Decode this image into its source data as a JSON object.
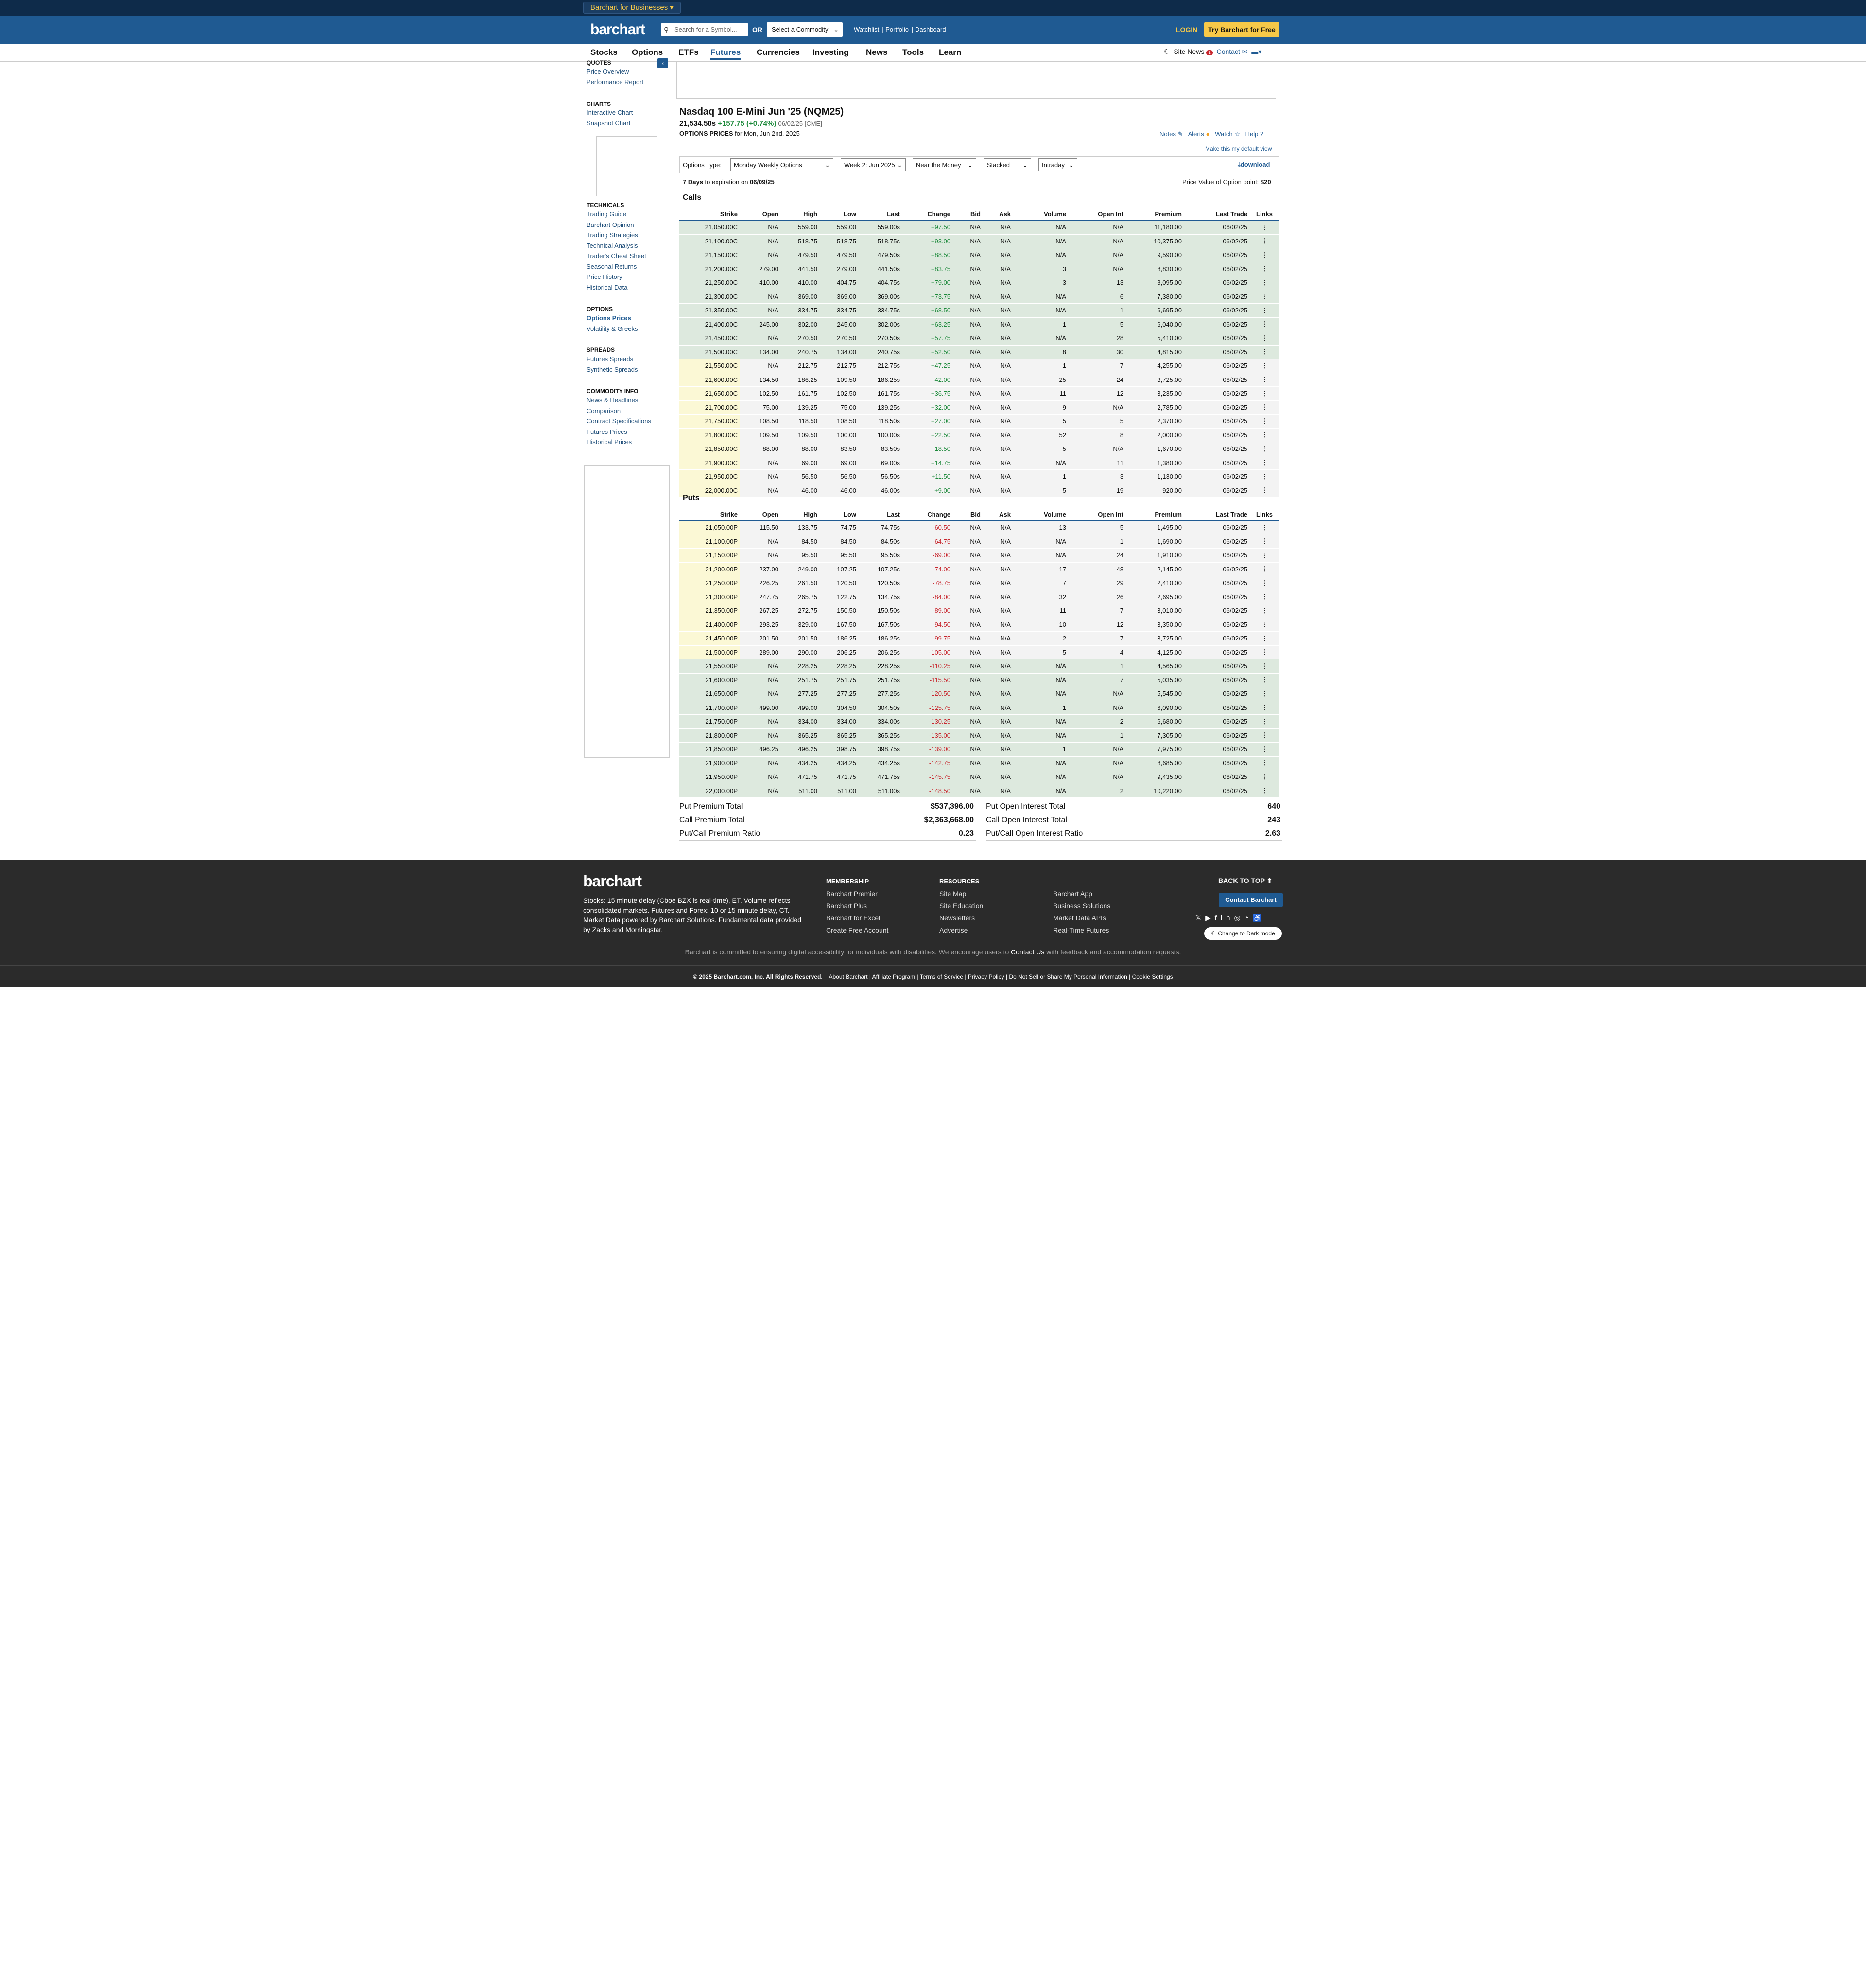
{
  "topbar": {
    "business_label": "Barchart for Businesses"
  },
  "header": {
    "logo": "barchart",
    "search_placeholder": "Search for a Symbol...",
    "or_label": "OR",
    "commodity_select": "Select a Commodity",
    "links": [
      "Watchlist",
      "Portfolio",
      "Dashboard"
    ],
    "login": "LOGIN",
    "try_button": "Try Barchart for Free"
  },
  "nav": {
    "items": [
      "Stocks",
      "Options",
      "ETFs",
      "Futures",
      "Currencies",
      "Investing",
      "News",
      "Tools",
      "Learn"
    ],
    "active": "Futures",
    "site_news": "Site News",
    "site_news_badge": "1",
    "contact": "Contact"
  },
  "sidebar": {
    "quotes_header": "QUOTES",
    "quotes": [
      "Price Overview",
      "Performance Report"
    ],
    "charts_header": "CHARTS",
    "charts": [
      "Interactive Chart",
      "Snapshot Chart"
    ],
    "technicals_header": "TECHNICALS",
    "technicals": [
      "Trading Guide",
      "Barchart Opinion",
      "Trading Strategies",
      "Technical Analysis",
      "Trader's Cheat Sheet",
      "Seasonal Returns",
      "Price History",
      "Historical Data"
    ],
    "options_header": "OPTIONS",
    "options": [
      "Options Prices",
      "Volatility & Greeks"
    ],
    "spreads_header": "SPREADS",
    "spreads": [
      "Futures Spreads",
      "Synthetic Spreads"
    ],
    "commodity_header": "COMMODITY INFO",
    "commodity": [
      "News & Headlines",
      "Comparison",
      "Contract Specifications",
      "Futures Prices",
      "Historical Prices"
    ]
  },
  "quote": {
    "title": "Nasdaq 100 E-Mini Jun '25 (NQM25)",
    "last": "21,534.50s",
    "change": "+157.75 (+0.74%)",
    "date": "06/02/25 [CME]",
    "options_prices_label": "OPTIONS PRICES",
    "for_date": "for Mon, Jun 2nd, 2025"
  },
  "tools": {
    "notes": "Notes",
    "alerts": "Alerts",
    "watch": "Watch",
    "help": "Help",
    "default_view": "Make this my default view"
  },
  "filters": {
    "options_type_label": "Options Type:",
    "options_type": "Monday Weekly Options",
    "expiration": "Week 2: Jun 2025",
    "moneyness": "Near the Money",
    "layout": "Stacked",
    "period": "Intraday",
    "download": "download"
  },
  "expiry": {
    "days": "7 Days",
    "text": "to expiration on",
    "date": "06/09/25",
    "point_label": "Price Value of Option point:",
    "point_value": "$20"
  },
  "columns": [
    "Strike",
    "Open",
    "High",
    "Low",
    "Last",
    "Change",
    "Bid",
    "Ask",
    "Volume",
    "Open Int",
    "Premium",
    "Last Trade",
    "Links"
  ],
  "calls_label": "Calls",
  "puts_label": "Puts",
  "calls": [
    [
      "21,050.00C",
      "N/A",
      "559.00",
      "559.00",
      "559.00s",
      "+97.50",
      "N/A",
      "N/A",
      "N/A",
      "N/A",
      "11,180.00",
      "06/02/25",
      "⋮"
    ],
    [
      "21,100.00C",
      "N/A",
      "518.75",
      "518.75",
      "518.75s",
      "+93.00",
      "N/A",
      "N/A",
      "N/A",
      "N/A",
      "10,375.00",
      "06/02/25",
      "⋮"
    ],
    [
      "21,150.00C",
      "N/A",
      "479.50",
      "479.50",
      "479.50s",
      "+88.50",
      "N/A",
      "N/A",
      "N/A",
      "N/A",
      "9,590.00",
      "06/02/25",
      "⋮"
    ],
    [
      "21,200.00C",
      "279.00",
      "441.50",
      "279.00",
      "441.50s",
      "+83.75",
      "N/A",
      "N/A",
      "3",
      "N/A",
      "8,830.00",
      "06/02/25",
      "⋮"
    ],
    [
      "21,250.00C",
      "410.00",
      "410.00",
      "404.75",
      "404.75s",
      "+79.00",
      "N/A",
      "N/A",
      "3",
      "13",
      "8,095.00",
      "06/02/25",
      "⋮"
    ],
    [
      "21,300.00C",
      "N/A",
      "369.00",
      "369.00",
      "369.00s",
      "+73.75",
      "N/A",
      "N/A",
      "N/A",
      "6",
      "7,380.00",
      "06/02/25",
      "⋮"
    ],
    [
      "21,350.00C",
      "N/A",
      "334.75",
      "334.75",
      "334.75s",
      "+68.50",
      "N/A",
      "N/A",
      "N/A",
      "1",
      "6,695.00",
      "06/02/25",
      "⋮"
    ],
    [
      "21,400.00C",
      "245.00",
      "302.00",
      "245.00",
      "302.00s",
      "+63.25",
      "N/A",
      "N/A",
      "1",
      "5",
      "6,040.00",
      "06/02/25",
      "⋮"
    ],
    [
      "21,450.00C",
      "N/A",
      "270.50",
      "270.50",
      "270.50s",
      "+57.75",
      "N/A",
      "N/A",
      "N/A",
      "28",
      "5,410.00",
      "06/02/25",
      "⋮"
    ],
    [
      "21,500.00C",
      "134.00",
      "240.75",
      "134.00",
      "240.75s",
      "+52.50",
      "N/A",
      "N/A",
      "8",
      "30",
      "4,815.00",
      "06/02/25",
      "⋮"
    ],
    [
      "21,550.00C",
      "N/A",
      "212.75",
      "212.75",
      "212.75s",
      "+47.25",
      "N/A",
      "N/A",
      "1",
      "7",
      "4,255.00",
      "06/02/25",
      "⋮"
    ],
    [
      "21,600.00C",
      "134.50",
      "186.25",
      "109.50",
      "186.25s",
      "+42.00",
      "N/A",
      "N/A",
      "25",
      "24",
      "3,725.00",
      "06/02/25",
      "⋮"
    ],
    [
      "21,650.00C",
      "102.50",
      "161.75",
      "102.50",
      "161.75s",
      "+36.75",
      "N/A",
      "N/A",
      "11",
      "12",
      "3,235.00",
      "06/02/25",
      "⋮"
    ],
    [
      "21,700.00C",
      "75.00",
      "139.25",
      "75.00",
      "139.25s",
      "+32.00",
      "N/A",
      "N/A",
      "9",
      "N/A",
      "2,785.00",
      "06/02/25",
      "⋮"
    ],
    [
      "21,750.00C",
      "108.50",
      "118.50",
      "108.50",
      "118.50s",
      "+27.00",
      "N/A",
      "N/A",
      "5",
      "5",
      "2,370.00",
      "06/02/25",
      "⋮"
    ],
    [
      "21,800.00C",
      "109.50",
      "109.50",
      "100.00",
      "100.00s",
      "+22.50",
      "N/A",
      "N/A",
      "52",
      "8",
      "2,000.00",
      "06/02/25",
      "⋮"
    ],
    [
      "21,850.00C",
      "88.00",
      "88.00",
      "83.50",
      "83.50s",
      "+18.50",
      "N/A",
      "N/A",
      "5",
      "N/A",
      "1,670.00",
      "06/02/25",
      "⋮"
    ],
    [
      "21,900.00C",
      "N/A",
      "69.00",
      "69.00",
      "69.00s",
      "+14.75",
      "N/A",
      "N/A",
      "N/A",
      "11",
      "1,380.00",
      "06/02/25",
      "⋮"
    ],
    [
      "21,950.00C",
      "N/A",
      "56.50",
      "56.50",
      "56.50s",
      "+11.50",
      "N/A",
      "N/A",
      "1",
      "3",
      "1,130.00",
      "06/02/25",
      "⋮"
    ],
    [
      "22,000.00C",
      "N/A",
      "46.00",
      "46.00",
      "46.00s",
      "+9.00",
      "N/A",
      "N/A",
      "5",
      "19",
      "920.00",
      "06/02/25",
      "⋮"
    ]
  ],
  "puts": [
    [
      "21,050.00P",
      "115.50",
      "133.75",
      "74.75",
      "74.75s",
      "-60.50",
      "N/A",
      "N/A",
      "13",
      "5",
      "1,495.00",
      "06/02/25",
      "⋮"
    ],
    [
      "21,100.00P",
      "N/A",
      "84.50",
      "84.50",
      "84.50s",
      "-64.75",
      "N/A",
      "N/A",
      "N/A",
      "1",
      "1,690.00",
      "06/02/25",
      "⋮"
    ],
    [
      "21,150.00P",
      "N/A",
      "95.50",
      "95.50",
      "95.50s",
      "-69.00",
      "N/A",
      "N/A",
      "N/A",
      "24",
      "1,910.00",
      "06/02/25",
      "⋮"
    ],
    [
      "21,200.00P",
      "237.00",
      "249.00",
      "107.25",
      "107.25s",
      "-74.00",
      "N/A",
      "N/A",
      "17",
      "48",
      "2,145.00",
      "06/02/25",
      "⋮"
    ],
    [
      "21,250.00P",
      "226.25",
      "261.50",
      "120.50",
      "120.50s",
      "-78.75",
      "N/A",
      "N/A",
      "7",
      "29",
      "2,410.00",
      "06/02/25",
      "⋮"
    ],
    [
      "21,300.00P",
      "247.75",
      "265.75",
      "122.75",
      "134.75s",
      "-84.00",
      "N/A",
      "N/A",
      "32",
      "26",
      "2,695.00",
      "06/02/25",
      "⋮"
    ],
    [
      "21,350.00P",
      "267.25",
      "272.75",
      "150.50",
      "150.50s",
      "-89.00",
      "N/A",
      "N/A",
      "11",
      "7",
      "3,010.00",
      "06/02/25",
      "⋮"
    ],
    [
      "21,400.00P",
      "293.25",
      "329.00",
      "167.50",
      "167.50s",
      "-94.50",
      "N/A",
      "N/A",
      "10",
      "12",
      "3,350.00",
      "06/02/25",
      "⋮"
    ],
    [
      "21,450.00P",
      "201.50",
      "201.50",
      "186.25",
      "186.25s",
      "-99.75",
      "N/A",
      "N/A",
      "2",
      "7",
      "3,725.00",
      "06/02/25",
      "⋮"
    ],
    [
      "21,500.00P",
      "289.00",
      "290.00",
      "206.25",
      "206.25s",
      "-105.00",
      "N/A",
      "N/A",
      "5",
      "4",
      "4,125.00",
      "06/02/25",
      "⋮"
    ],
    [
      "21,550.00P",
      "N/A",
      "228.25",
      "228.25",
      "228.25s",
      "-110.25",
      "N/A",
      "N/A",
      "N/A",
      "1",
      "4,565.00",
      "06/02/25",
      "⋮"
    ],
    [
      "21,600.00P",
      "N/A",
      "251.75",
      "251.75",
      "251.75s",
      "-115.50",
      "N/A",
      "N/A",
      "N/A",
      "7",
      "5,035.00",
      "06/02/25",
      "⋮"
    ],
    [
      "21,650.00P",
      "N/A",
      "277.25",
      "277.25",
      "277.25s",
      "-120.50",
      "N/A",
      "N/A",
      "N/A",
      "N/A",
      "5,545.00",
      "06/02/25",
      "⋮"
    ],
    [
      "21,700.00P",
      "499.00",
      "499.00",
      "304.50",
      "304.50s",
      "-125.75",
      "N/A",
      "N/A",
      "1",
      "N/A",
      "6,090.00",
      "06/02/25",
      "⋮"
    ],
    [
      "21,750.00P",
      "N/A",
      "334.00",
      "334.00",
      "334.00s",
      "-130.25",
      "N/A",
      "N/A",
      "N/A",
      "2",
      "6,680.00",
      "06/02/25",
      "⋮"
    ],
    [
      "21,800.00P",
      "N/A",
      "365.25",
      "365.25",
      "365.25s",
      "-135.00",
      "N/A",
      "N/A",
      "N/A",
      "1",
      "7,305.00",
      "06/02/25",
      "⋮"
    ],
    [
      "21,850.00P",
      "496.25",
      "496.25",
      "398.75",
      "398.75s",
      "-139.00",
      "N/A",
      "N/A",
      "1",
      "N/A",
      "7,975.00",
      "06/02/25",
      "⋮"
    ],
    [
      "21,900.00P",
      "N/A",
      "434.25",
      "434.25",
      "434.25s",
      "-142.75",
      "N/A",
      "N/A",
      "N/A",
      "N/A",
      "8,685.00",
      "06/02/25",
      "⋮"
    ],
    [
      "21,950.00P",
      "N/A",
      "471.75",
      "471.75",
      "471.75s",
      "-145.75",
      "N/A",
      "N/A",
      "N/A",
      "N/A",
      "9,435.00",
      "06/02/25",
      "⋮"
    ],
    [
      "22,000.00P",
      "N/A",
      "511.00",
      "511.00",
      "511.00s",
      "-148.50",
      "N/A",
      "N/A",
      "N/A",
      "2",
      "10,220.00",
      "06/02/25",
      "⋮"
    ]
  ],
  "totals": {
    "put_premium_label": "Put Premium Total",
    "put_premium": "$537,396.00",
    "call_premium_label": "Call Premium Total",
    "call_premium": "$2,363,668.00",
    "pc_premium_label": "Put/Call Premium Ratio",
    "pc_premium": "0.23",
    "put_oi_label": "Put Open Interest Total",
    "put_oi": "640",
    "call_oi_label": "Call Open Interest Total",
    "call_oi": "243",
    "pc_oi_label": "Put/Call Open Interest Ratio",
    "pc_oi": "2.63"
  },
  "footer": {
    "logo": "barchart",
    "desc_1": "Stocks: 15 minute delay (Cboe BZX is real-time), ET. Volume reflects consolidated markets. Futures and Forex: 10 or 15 minute delay, CT.",
    "market_data": "Market Data",
    "desc_2": "powered by Barchart Solutions. Fundamental data provided by Zacks and",
    "morningstar": "Morningstar",
    "membership_header": "MEMBERSHIP",
    "membership": [
      "Barchart Premier",
      "Barchart Plus",
      "Barchart for Excel",
      "Create Free Account"
    ],
    "resources_header": "RESOURCES",
    "resources": [
      "Site Map",
      "Site Education",
      "Newsletters",
      "Advertise"
    ],
    "more": [
      "Barchart App",
      "Business Solutions",
      "Market Data APIs",
      "Real-Time Futures"
    ],
    "back_to_top": "BACK TO TOP",
    "contact_button": "Contact Barchart",
    "dark_mode": "Change to Dark mode",
    "accessibility": "Barchart is committed to ensuring digital accessibility for individuals with disabilities. We encourage users to",
    "contact_us": "Contact Us",
    "accessibility_end": "with feedback and accommodation requests.",
    "copyright": "© 2025 Barchart.com, Inc. All Rights Reserved.",
    "legal_links": [
      "About Barchart",
      "Affiliate Program",
      "Terms of Service",
      "Privacy Policy",
      "Do Not Sell or Share My Personal Information",
      "Cookie Settings"
    ]
  }
}
